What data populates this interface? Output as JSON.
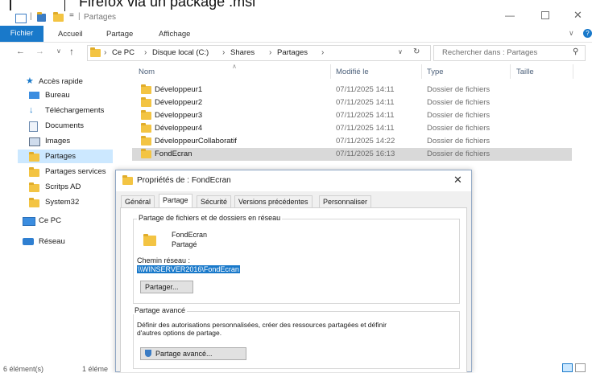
{
  "window": {
    "top_caption": "Firefox via un package .msi",
    "title": "Partages",
    "quick_access_sep": "="
  },
  "ribbon": {
    "file_tab": "Fichier",
    "tabs": [
      "Accueil",
      "Partage",
      "Affichage"
    ]
  },
  "address": {
    "crumbs": [
      "Ce PC",
      "Disque local (C:)",
      "Shares",
      "Partages"
    ],
    "search_placeholder": "Rechercher dans : Partages"
  },
  "sidebar": {
    "quick_access": "Accès rapide",
    "items": [
      {
        "label": "Bureau",
        "icon": "desktop-icon",
        "pinned": true
      },
      {
        "label": "Téléchargements",
        "icon": "download-icon",
        "pinned": true
      },
      {
        "label": "Documents",
        "icon": "documents-icon",
        "pinned": true
      },
      {
        "label": "Images",
        "icon": "images-icon",
        "pinned": true
      },
      {
        "label": "Partages",
        "icon": "folder-icon",
        "pinned": false
      },
      {
        "label": "Partages services",
        "icon": "folder-icon",
        "pinned": false
      },
      {
        "label": "Scritps AD",
        "icon": "folder-icon",
        "pinned": false
      },
      {
        "label": "System32",
        "icon": "folder-icon",
        "pinned": false
      }
    ],
    "this_pc": "Ce PC",
    "network": "Réseau"
  },
  "list": {
    "columns": [
      "Nom",
      "Modifié le",
      "Type",
      "Taille"
    ],
    "rows": [
      {
        "name": "Développeur1",
        "date": "07/11/2025 14:11",
        "type": "Dossier de fichiers"
      },
      {
        "name": "Développeur2",
        "date": "07/11/2025 14:11",
        "type": "Dossier de fichiers"
      },
      {
        "name": "Développeur3",
        "date": "07/11/2025 14:11",
        "type": "Dossier de fichiers"
      },
      {
        "name": "Développeur4",
        "date": "07/11/2025 14:11",
        "type": "Dossier de fichiers"
      },
      {
        "name": "DéveloppeurCollaboratif",
        "date": "07/11/2025 14:22",
        "type": "Dossier de fichiers"
      },
      {
        "name": "FondEcran",
        "date": "07/11/2025 16:13",
        "type": "Dossier de fichiers",
        "selected": true
      }
    ]
  },
  "status": {
    "count": "6 élément(s)",
    "selection": "1 éléme"
  },
  "dialog": {
    "title": "Propriétés de : FondEcran",
    "tabs": [
      "Général",
      "Partage",
      "Sécurité",
      "Versions précédentes",
      "Personnaliser"
    ],
    "active_tab": "Partage",
    "network_group_title": "Partage de fichiers et de dossiers en réseau",
    "folder_name": "FondEcran",
    "share_state": "Partagé",
    "network_path_label": "Chemin réseau :",
    "network_path": "\\\\WINSERVER2016\\FondEcran",
    "share_button": "Partager...",
    "advanced_group_title": "Partage avancé",
    "advanced_desc_1": "Définir des autorisations personnalisées, créer des ressources partagées et définir",
    "advanced_desc_2": "d'autres options de partage.",
    "advanced_button": "Partage avancé..."
  }
}
